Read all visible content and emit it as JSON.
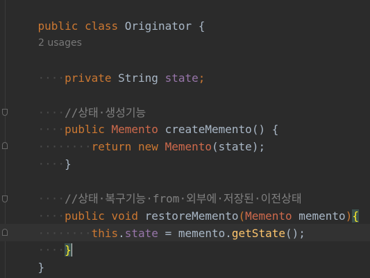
{
  "code": {
    "class_line": {
      "kw1": "public",
      "kw2": "class",
      "name": "Originator",
      "brace": "{"
    },
    "usages_hint": "2 usages",
    "field_line": {
      "dots": "····",
      "kw": "private",
      "type": "String",
      "name": "state",
      "semi": ";"
    },
    "comment1": {
      "dots": "····",
      "text": "//상태·생성기능"
    },
    "method1_sig": {
      "dots": "····",
      "kw": "public",
      "type": "Memento",
      "name": "createMemento",
      "rest": "() {"
    },
    "method1_body": {
      "dots": "········",
      "kw1": "return",
      "kw2": "new",
      "type": "Memento",
      "rest": "(state);"
    },
    "method1_close": {
      "dots": "····",
      "brace": "}"
    },
    "comment2": {
      "dots": "····",
      "text": "//상태·복구기능·from·외부에·저장된·이전상태"
    },
    "method2_sig": {
      "dots": "····",
      "kw1": "public",
      "kw2": "void",
      "name": "restoreMemento",
      "paren_open": "(",
      "ptype": "Memento",
      "pname": "memento",
      "paren_close": ")",
      "brace": "{"
    },
    "method2_body": {
      "dots": "········",
      "kw": "this",
      "dot": ".",
      "field": "state",
      "eq": " = memento.",
      "fn": "getState",
      "rest": "();"
    },
    "method2_close": {
      "dots": "····",
      "brace": "}"
    },
    "class_close": {
      "brace": "}"
    }
  }
}
